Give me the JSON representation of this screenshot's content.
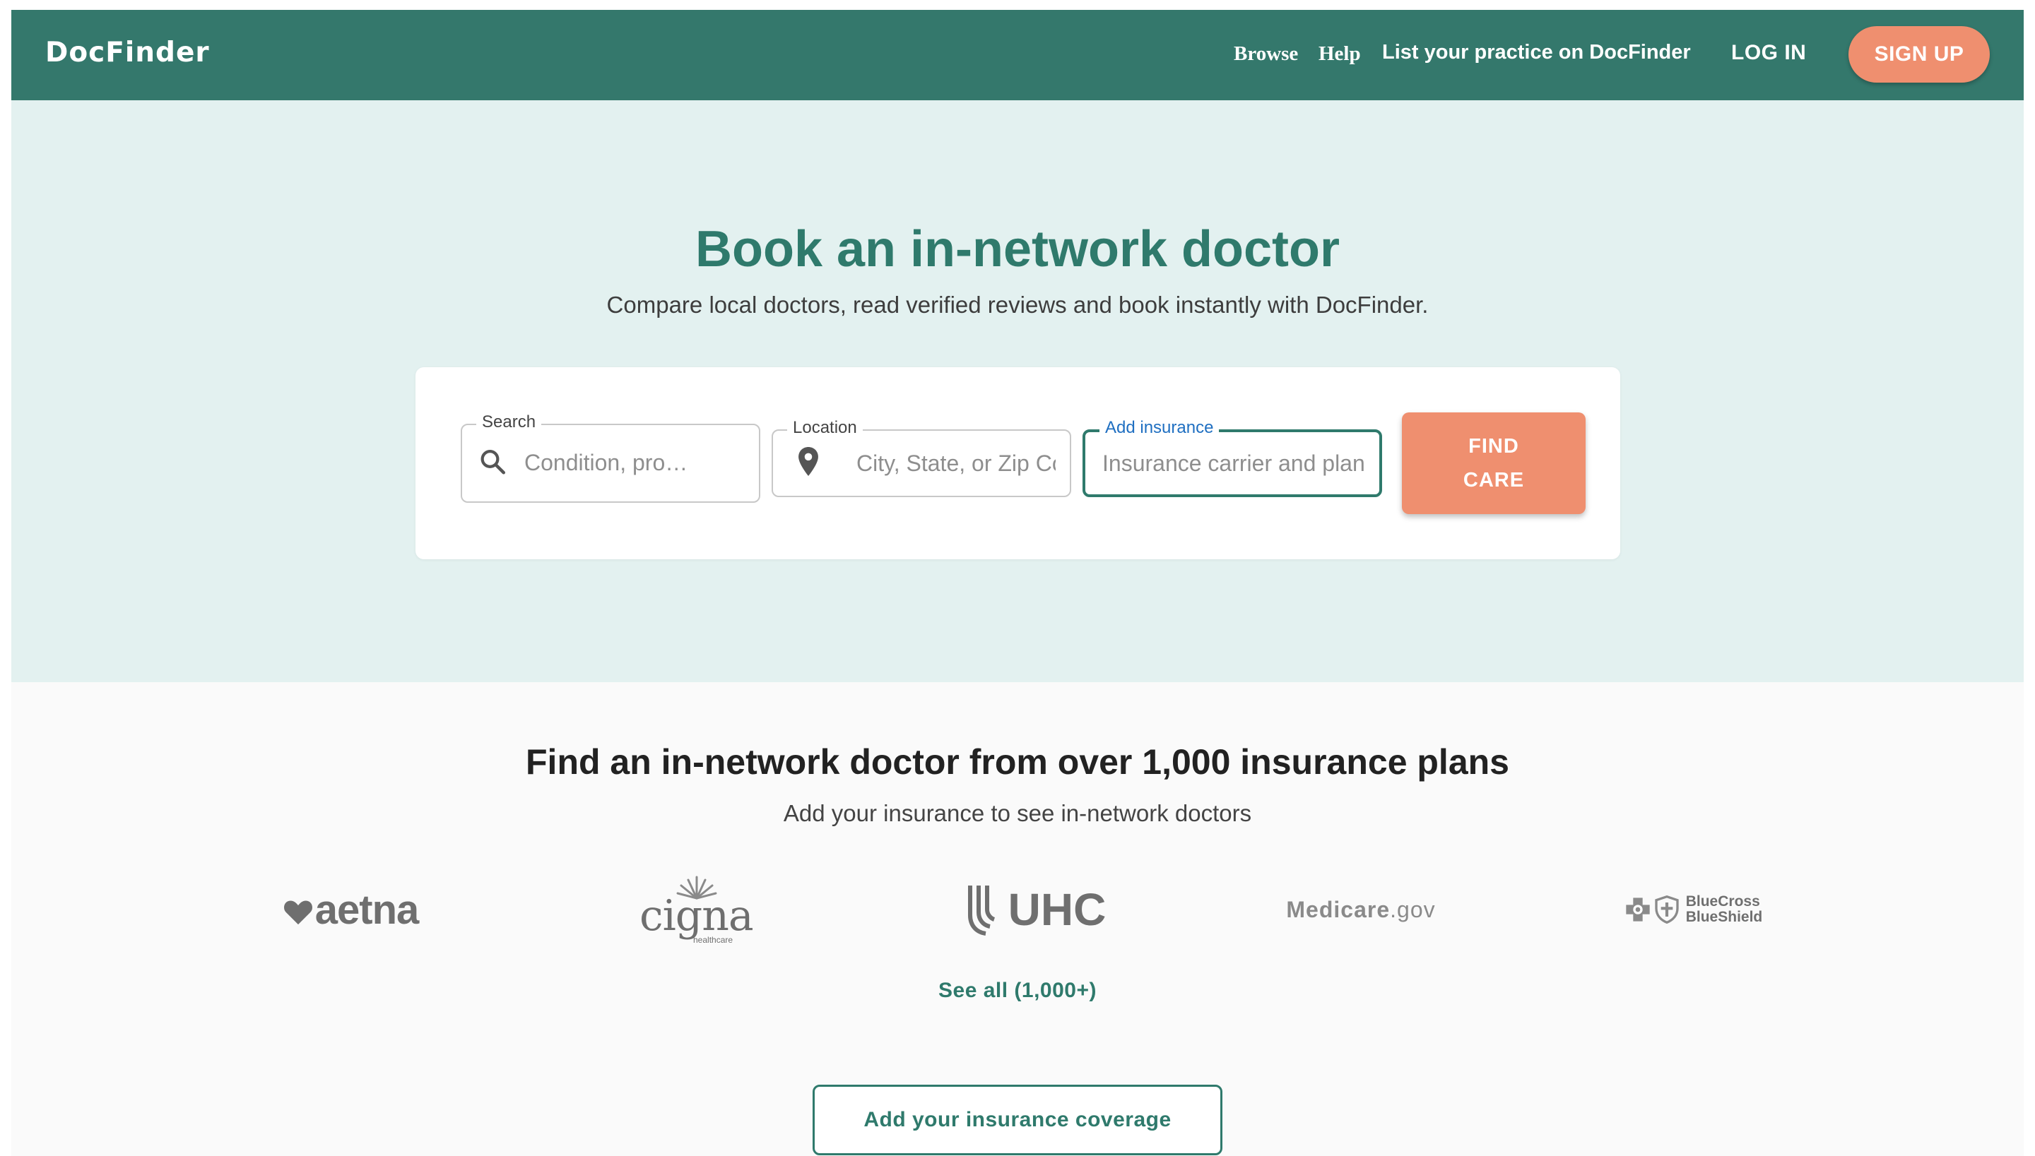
{
  "header": {
    "brand": "DocFinder",
    "nav": {
      "browse": "Browse",
      "help": "Help",
      "list_practice": "List your practice on DocFinder",
      "login": "LOG IN",
      "signup": "SIGN UP"
    }
  },
  "hero": {
    "title": "Book an in-network doctor",
    "subtitle": "Compare local doctors, read verified reviews and book instantly with DocFinder.",
    "search": {
      "label": "Search",
      "placeholder": "Condition, pro…",
      "icon": "search-icon"
    },
    "location": {
      "label": "Location",
      "placeholder": "City, State, or Zip Code",
      "icon": "map-pin-icon"
    },
    "insurance": {
      "label": "Add insurance",
      "placeholder": "Insurance carrier and plan"
    },
    "find_button": [
      "FIND",
      "CARE"
    ]
  },
  "insurance_section": {
    "title": "Find an in-network doctor from over 1,000 insurance plans",
    "subtitle": "Add your insurance to see in-network doctors",
    "logos": {
      "aetna": "aetna",
      "cigna": "cigna",
      "cigna_tag": "healthcare",
      "uhc": "UHC",
      "medicare_a": "Medicare",
      "medicare_b": ".gov",
      "bcbs_line1": "BlueCross",
      "bcbs_line2": "BlueShield"
    },
    "see_all": "See all (1,000+)",
    "add_coverage": "Add your insurance coverage"
  },
  "colors": {
    "brand_green": "#34786c",
    "accent_orange": "#ef8f6f",
    "hero_bg": "#e3f1f0",
    "title_green": "#2f7a6c",
    "focus_label_blue": "#1f6fc1"
  }
}
